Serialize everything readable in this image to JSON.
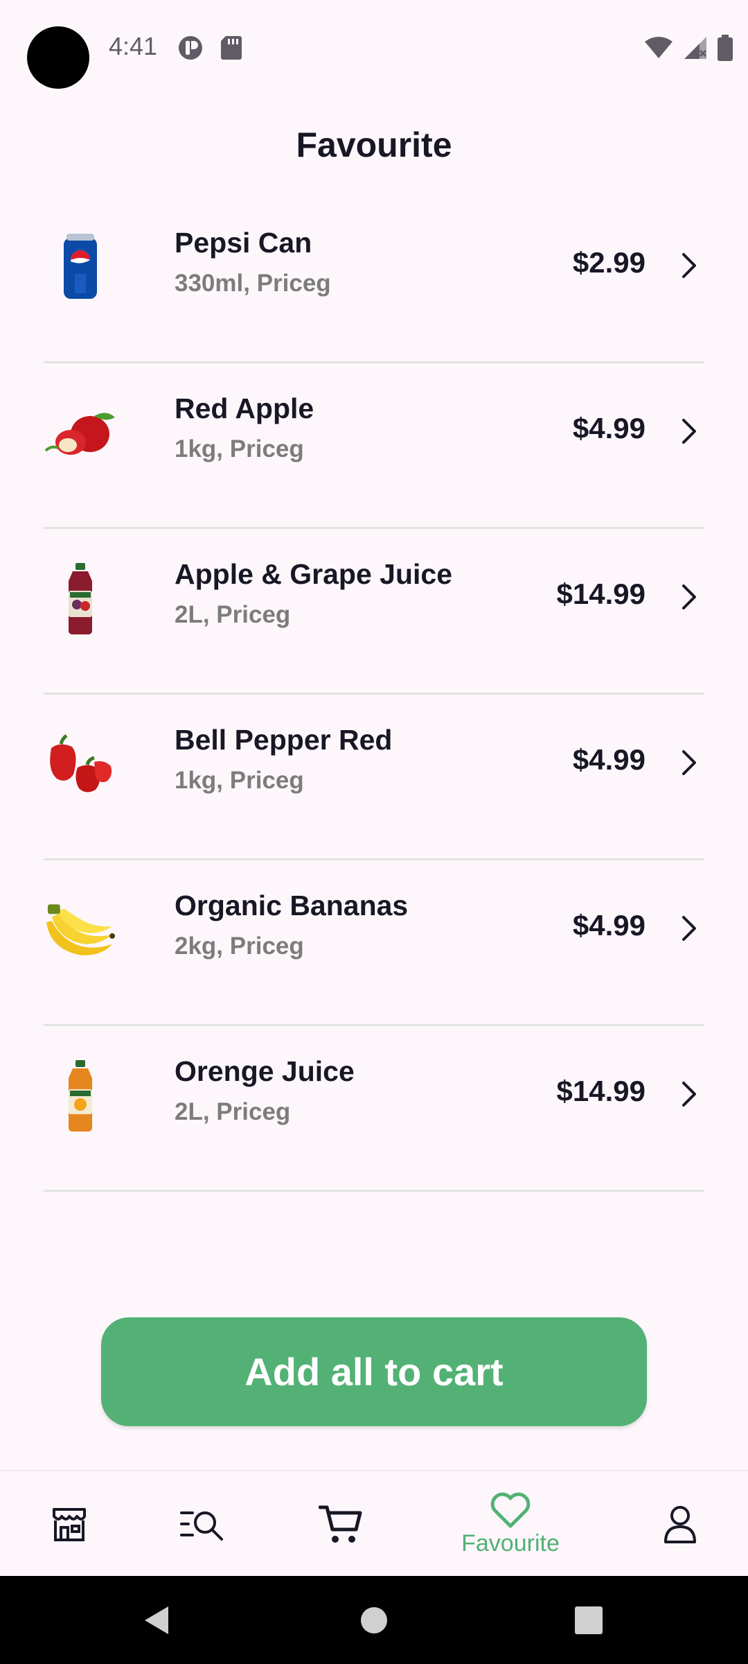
{
  "status_bar": {
    "time": "4:41"
  },
  "header": {
    "title": "Favourite"
  },
  "items": [
    {
      "name": "Pepsi Can",
      "subtitle": "330ml, Priceg",
      "price": "$2.99",
      "icon": "pepsi-can-image"
    },
    {
      "name": "Red Apple",
      "subtitle": "1kg, Priceg",
      "price": "$4.99",
      "icon": "red-apple-image"
    },
    {
      "name": "Apple & Grape Juice",
      "subtitle": "2L, Priceg",
      "price": "$14.99",
      "icon": "grape-juice-bottle-image"
    },
    {
      "name": "Bell Pepper Red",
      "subtitle": "1kg, Priceg",
      "price": "$4.99",
      "icon": "bell-pepper-image"
    },
    {
      "name": "Organic Bananas",
      "subtitle": "2kg, Priceg",
      "price": "$4.99",
      "icon": "bananas-image"
    },
    {
      "name": "Orenge Juice",
      "subtitle": "2L, Priceg",
      "price": "$14.99",
      "icon": "orange-juice-bottle-image"
    }
  ],
  "cta": {
    "label": "Add all to cart"
  },
  "bottom_nav": {
    "items": [
      {
        "id": "shop",
        "icon": "store-icon",
        "label": ""
      },
      {
        "id": "explore",
        "icon": "search-list-icon",
        "label": ""
      },
      {
        "id": "cart",
        "icon": "cart-icon",
        "label": ""
      },
      {
        "id": "favourite",
        "icon": "heart-icon",
        "label": "Favourite",
        "active": true
      },
      {
        "id": "account",
        "icon": "user-icon",
        "label": ""
      }
    ]
  },
  "colors": {
    "accent": "#53b175",
    "background": "#fdf7fc",
    "text_primary": "#181725",
    "text_secondary": "#7c7c7c",
    "divider": "#e2e2e2"
  }
}
